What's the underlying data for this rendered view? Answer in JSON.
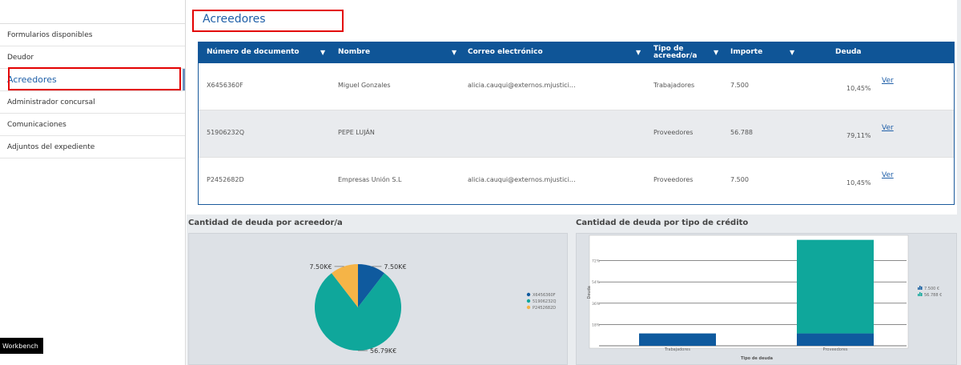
{
  "sidebar": {
    "items": [
      {
        "label": "Formularios disponibles",
        "active": false
      },
      {
        "label": "Deudor",
        "active": false
      },
      {
        "label": "Acreedores",
        "active": true
      },
      {
        "label": "Administrador concursal",
        "active": false
      },
      {
        "label": "Comunicaciones",
        "active": false
      },
      {
        "label": "Adjuntos del expediente",
        "active": false
      }
    ],
    "workbench_label": "Workbench"
  },
  "main": {
    "title": "Acreedores",
    "table": {
      "headers": [
        "Número de documento",
        "Nombre",
        "Correo electrónico",
        "Tipo de acreedor/a",
        "Importe",
        "Deuda"
      ],
      "rows": [
        {
          "doc": "X6456360F",
          "nombre": "Miguel Gonzales",
          "correo": "alicia.cauqui@externos.mjustici…",
          "tipo": "Trabajadores",
          "importe": "7.500",
          "deuda": "10,45%",
          "ver": "Ver"
        },
        {
          "doc": "51906232Q",
          "nombre": "PEPE LUJÁN",
          "correo": "",
          "tipo": "Proveedores",
          "importe": "56.788",
          "deuda": "79,11%",
          "ver": "Ver"
        },
        {
          "doc": "P2452682D",
          "nombre": "Empresas Unión S.L",
          "correo": "alicia.cauqui@externos.mjustici…",
          "tipo": "Proveedores",
          "importe": "7.500",
          "deuda": "10,45%",
          "ver": "Ver"
        }
      ]
    }
  },
  "charts": {
    "pie_title": "Cantidad de deuda por acreedor/a",
    "bar_title": "Cantidad de deuda por tipo de crédito"
  },
  "colors": {
    "blue": "#0f5a9e",
    "teal": "#0fa79b",
    "orange": "#f5b447",
    "header": "#0f5597",
    "accent": "#1f5fa8",
    "highlight": "#e30000"
  },
  "chart_data": [
    {
      "type": "pie",
      "title": "Cantidad de deuda por acreedor/a",
      "labels": [
        "X6456360F",
        "51906232Q",
        "P2452682D"
      ],
      "values": [
        7500,
        56788,
        7500
      ],
      "data_labels": [
        "7.50K€",
        "56.79K€",
        "7.50K€"
      ],
      "legend": "right"
    },
    {
      "type": "bar",
      "stacked": true,
      "title": "Cantidad de deuda por tipo de crédito",
      "categories": [
        "Trabajadores",
        "Proveedores"
      ],
      "xlabel": "Tipo de deuda",
      "ylabel": "Deuda",
      "y_ticks": [
        "18%",
        "36%",
        "54%",
        "72%"
      ],
      "series": [
        {
          "name": "7.500 €",
          "values": [
            10.45,
            10.45
          ]
        },
        {
          "name": "56.788 €",
          "values": [
            0,
            79.11
          ]
        }
      ],
      "legend": "right"
    }
  ]
}
